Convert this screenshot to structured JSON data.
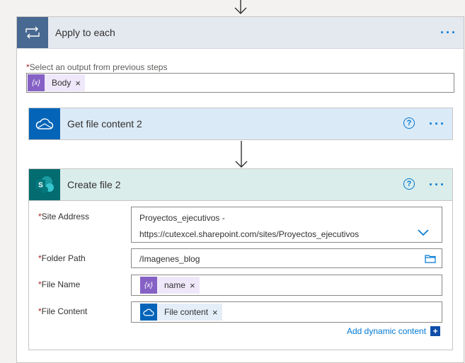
{
  "apply_each": {
    "title": "Apply to each",
    "menu_glyph": "···",
    "select_label": "Select an output from previous steps",
    "required_mark": "*",
    "token": {
      "label": "Body",
      "icon": "expression-icon",
      "icon_glyph": "{x}",
      "remove": "×"
    }
  },
  "get_file": {
    "title": "Get file content 2",
    "help_glyph": "?",
    "menu_glyph": "···",
    "icon": "onedrive-cloud-icon",
    "header_color": "#dbeaf7",
    "icon_bg": "#0364b8"
  },
  "create_file": {
    "title": "Create file 2",
    "help_glyph": "?",
    "menu_glyph": "···",
    "icon": "sharepoint-icon",
    "header_color": "#daedea",
    "icon_bg": "#036c70",
    "fields": {
      "site_address": {
        "label": "Site Address",
        "value_line1": "Proyectos_ejecutivos -",
        "value_line2": "https://cutexcel.sharepoint.com/sites/Proyectos_ejecutivos"
      },
      "folder_path": {
        "label": "Folder Path",
        "value": "/Imagenes_blog"
      },
      "file_name": {
        "label": "File Name",
        "token": {
          "label": "name",
          "icon_glyph": "{x}",
          "remove": "×"
        }
      },
      "file_content": {
        "label": "File Content",
        "token": {
          "label": "File content",
          "remove": "×"
        }
      }
    },
    "add_dynamic": {
      "label": "Add dynamic content",
      "plus": "+"
    }
  },
  "colors": {
    "accent": "#0078d4",
    "expression_purple": "#8661c5",
    "token_bg": "#efe8fb",
    "required": "#a4262c"
  }
}
